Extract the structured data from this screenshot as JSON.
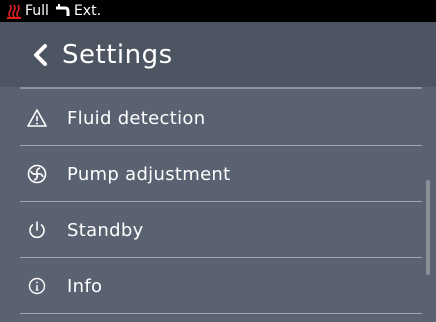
{
  "status_bar": {
    "heat_icon": "heating-icon",
    "level_text": "Full",
    "tap_icon": "tap-icon",
    "source_text": "Ext.",
    "heat_color": "#e02020"
  },
  "header": {
    "back_icon": "chevron-left-icon",
    "title": "Settings"
  },
  "menu": {
    "items": [
      {
        "icon": "warning-triangle-icon",
        "label": "Fluid detection"
      },
      {
        "icon": "pump-icon",
        "label": "Pump adjustment"
      },
      {
        "icon": "power-icon",
        "label": "Standby"
      },
      {
        "icon": "info-icon",
        "label": "Info"
      }
    ]
  },
  "colors": {
    "background": "#5a6170",
    "header": "#4d5462",
    "text": "#ffffff"
  }
}
